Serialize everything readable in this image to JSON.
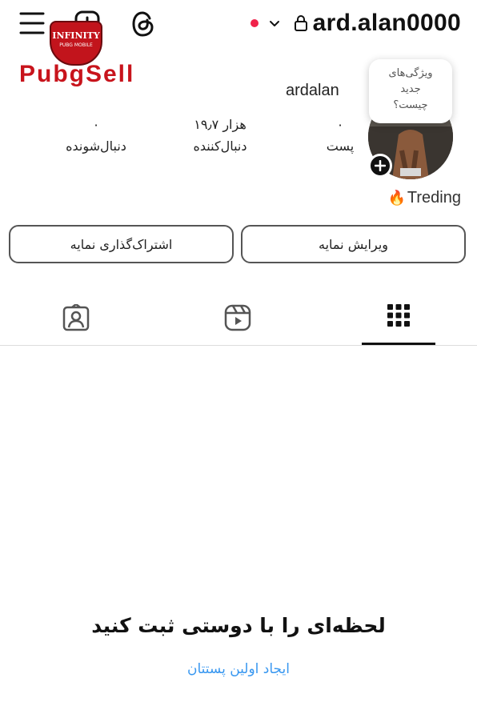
{
  "header": {
    "username": "ard.alan0000",
    "watermark_brand": "PubgSell",
    "watermark_badge_line1": "INFINITY",
    "watermark_badge_line2": "PUBG MOBILE",
    "notification_dot_color": "#f0224a"
  },
  "profile": {
    "display_name": "ardalan",
    "tooltip": [
      "ویژگی‌های",
      "جدید",
      "چیست؟"
    ],
    "note": "Treding",
    "note_emoji": "🔥",
    "stats": [
      {
        "value": "۰",
        "label": "پست"
      },
      {
        "value": "۱۹٫۷ هزار",
        "label": "دنبال‌کننده"
      },
      {
        "value": "۰",
        "label": "دنبال‌شونده"
      }
    ]
  },
  "actions": {
    "edit_label": "ویرایش نمایه",
    "share_label": "اشتراک‌گذاری نمایه"
  },
  "tabs": [
    {
      "name": "grid",
      "icon": "grid-icon",
      "active": true
    },
    {
      "name": "reels",
      "icon": "reels-icon",
      "active": false
    },
    {
      "name": "tagged",
      "icon": "tagged-icon",
      "active": false
    }
  ],
  "empty_state": {
    "title": "لحظه‌ای را با دوستی ثبت کنید",
    "link": "ایجاد اولین پستتان",
    "link_color": "#3897f0"
  }
}
